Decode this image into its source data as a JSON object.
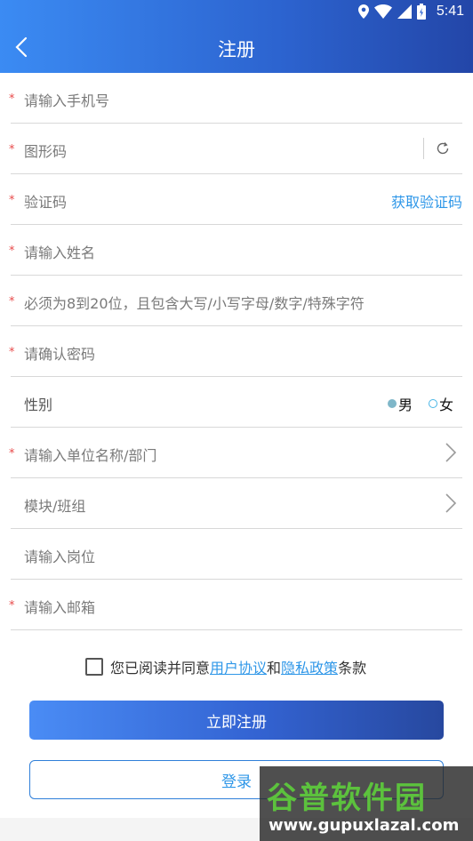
{
  "status": {
    "time": "5:41"
  },
  "header": {
    "title": "注册"
  },
  "form": {
    "phone_placeholder": "请输入手机号",
    "captcha_placeholder": "图形码",
    "code_placeholder": "验证码",
    "get_code_label": "获取验证码",
    "name_placeholder": "请输入姓名",
    "password_placeholder": "必须为8到20位，且包含大写/小写字母/数字/特殊字符",
    "confirm_placeholder": "请确认密码",
    "gender_label": "性别",
    "gender_male": "男",
    "gender_female": "女",
    "gender_selected": "男",
    "unit_placeholder": "请输入单位名称/部门",
    "module_placeholder": "模块/班组",
    "post_placeholder": "请输入岗位",
    "email_placeholder": "请输入邮箱"
  },
  "agreement": {
    "prefix": "您已阅读并同意",
    "user_agreement": "用户协议",
    "and": "和",
    "privacy_policy": "隐私政策",
    "suffix": "条款",
    "checked": false
  },
  "buttons": {
    "register": "立即注册",
    "login": "登录"
  },
  "watermark": {
    "title": "谷普软件园",
    "url": "www.gupuxlazal.com"
  },
  "colors": {
    "accent": "#2f97e8",
    "header_start": "#3b8bf3",
    "header_end": "#2346a8",
    "required": "#e84a4a"
  }
}
